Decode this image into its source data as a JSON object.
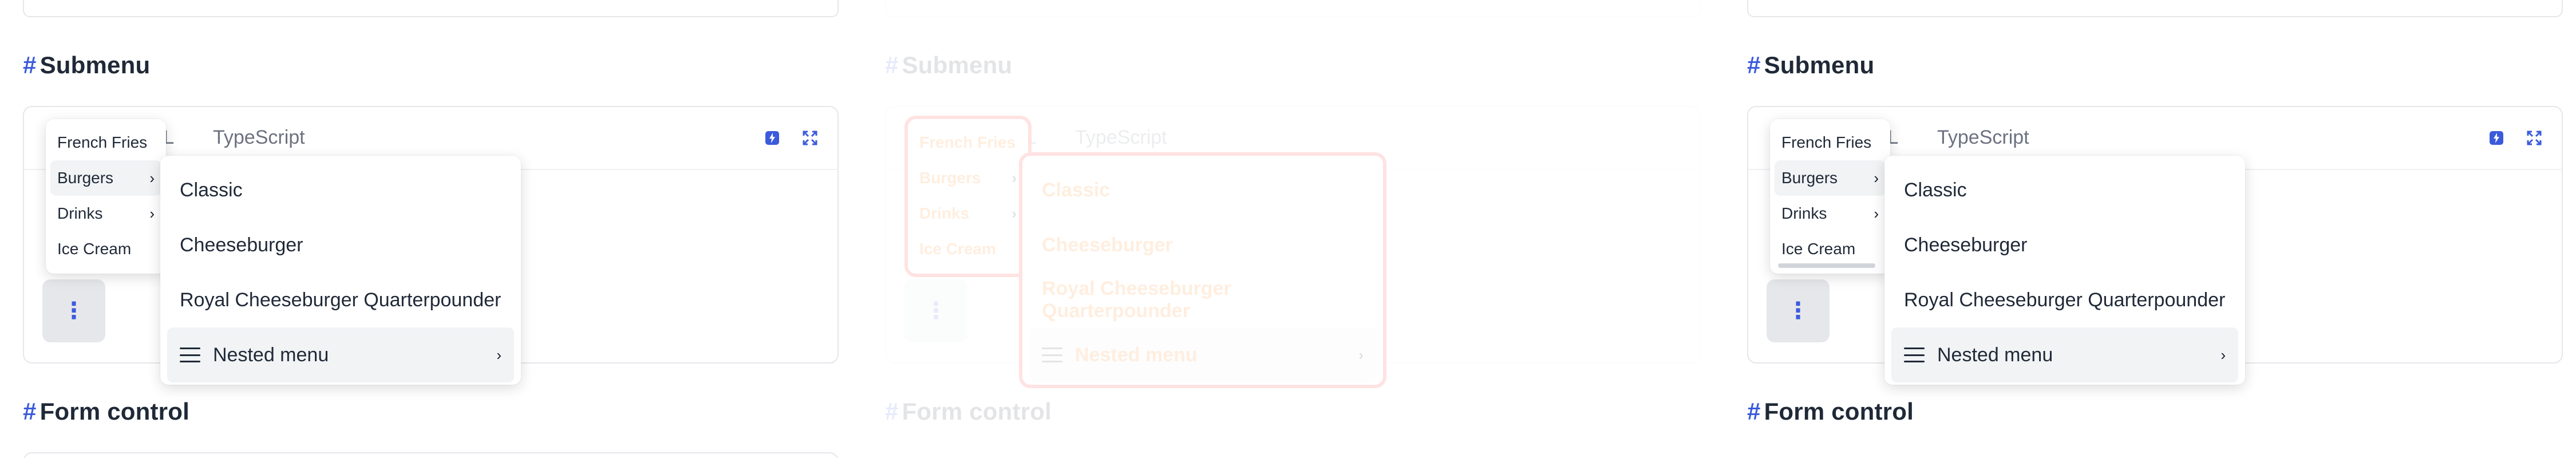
{
  "sections": {
    "submenu": {
      "hash": "#",
      "title": "Submenu"
    },
    "form_control": {
      "hash": "#",
      "title": "Form control"
    }
  },
  "tabs": [
    "HTML",
    "TypeScript"
  ],
  "tab_html_visible": "ML",
  "toolbar_icons": [
    "flash-icon",
    "expand-icon"
  ],
  "trigger": {
    "icon": "⋮"
  },
  "main_menu": {
    "items": [
      {
        "label": "French Fries",
        "has_submenu": false
      },
      {
        "label": "Burgers",
        "has_submenu": true
      },
      {
        "label": "Drinks",
        "has_submenu": true
      },
      {
        "label": "Ice Cream",
        "has_submenu": false
      }
    ]
  },
  "sub_menu": {
    "items": [
      {
        "label": "Classic"
      },
      {
        "label": "Cheeseburger"
      },
      {
        "label": "Royal Cheeseburger Quarterpounder"
      },
      {
        "label": "Nested menu",
        "has_submenu": true,
        "icon": "menu-icon"
      }
    ]
  },
  "chevron": "›",
  "colors": {
    "accent": "#3b5bdb",
    "highlight_outline": "#ff1a1a",
    "highlight_text": "#ff7a00"
  }
}
